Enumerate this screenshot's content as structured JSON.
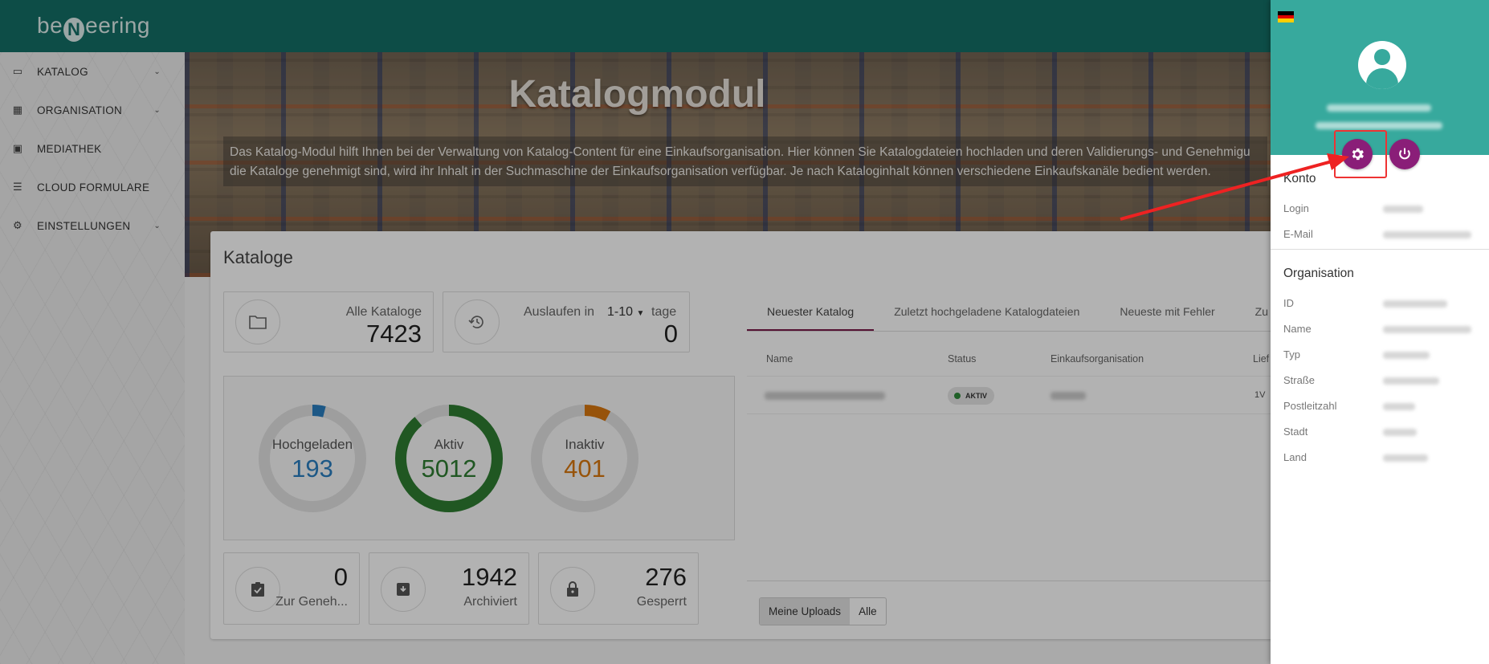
{
  "brand": {
    "pre": "be",
    "mid": "N",
    "post": "eering"
  },
  "sidebar": {
    "items": [
      {
        "label": "KATALOG",
        "icon": "folder-icon",
        "glyph": "▭",
        "chevron": true
      },
      {
        "label": "ORGANISATION",
        "icon": "building-icon",
        "glyph": "▦",
        "chevron": true
      },
      {
        "label": "MEDIATHEK",
        "icon": "photo-library-icon",
        "glyph": "▣",
        "chevron": false
      },
      {
        "label": "CLOUD FORMULARE",
        "icon": "list-icon",
        "glyph": "☰",
        "chevron": false
      },
      {
        "label": "EINSTELLUNGEN",
        "icon": "gear-icon",
        "glyph": "⚙",
        "chevron": true
      }
    ]
  },
  "hero": {
    "title": "Katalogmodul",
    "line1": "Das Katalog-Modul hilft Ihnen bei der Verwaltung von Katalog-Content für eine Einkaufsorganisation. Hier können Sie Katalogdateien hochladen und deren Validierungs- und Genehmigu",
    "line2": "die Kataloge genehmigt sind, wird ihr Inhalt in der Suchmaschine der Einkaufsorganisation verfügbar. Je nach Kataloginhalt können verschiedene Einkaufskanäle bedient werden."
  },
  "catalogs": {
    "title": "Kataloge",
    "all": {
      "label": "Alle Kataloge",
      "value": "7423"
    },
    "expiring": {
      "label": "Auslaufen in",
      "range": "1-10",
      "unit": "tage",
      "value": "0"
    },
    "donuts": [
      {
        "label": "Hochgeladen",
        "value": "193",
        "fraction": 0.04,
        "color": "#2a7fc0"
      },
      {
        "label": "Aktiv",
        "value": "5012",
        "fraction": 0.89,
        "color": "#2e7d32"
      },
      {
        "label": "Inaktiv",
        "value": "401",
        "fraction": 0.08,
        "color": "#d9780f"
      }
    ],
    "approval": {
      "label": "Zur Geneh...",
      "value": "0"
    },
    "archived": {
      "label": "Archiviert",
      "value": "1942"
    },
    "locked": {
      "label": "Gesperrt",
      "value": "276"
    }
  },
  "tabs": [
    {
      "label": "Neuester Katalog",
      "active": true
    },
    {
      "label": "Zuletzt hochgeladene Katalogdateien",
      "active": false
    },
    {
      "label": "Neueste mit Fehler",
      "active": false
    },
    {
      "label": "Zu",
      "active": false
    }
  ],
  "table": {
    "headers": {
      "name": "Name",
      "status": "Status",
      "org": "Einkaufsorganisation",
      "lief": "Lief"
    },
    "row": {
      "status": "AKTIV",
      "lief": "1V"
    }
  },
  "filter": {
    "mine": "Meine Uploads",
    "all": "Alle"
  },
  "panel": {
    "flag_colors": [
      "#000000",
      "#dd0000",
      "#ffce00"
    ],
    "konto_title": "Konto",
    "konto_rows": [
      "Login",
      "E-Mail"
    ],
    "org_title": "Organisation",
    "org_rows": [
      "ID",
      "Name",
      "Typ",
      "Straße",
      "Postleitzahl",
      "Stadt",
      "Land"
    ]
  },
  "colors": {
    "topbar": "#136f66",
    "panel_header": "#37a99d",
    "action_button": "#8a1e78",
    "highlight": "#ee3333"
  }
}
